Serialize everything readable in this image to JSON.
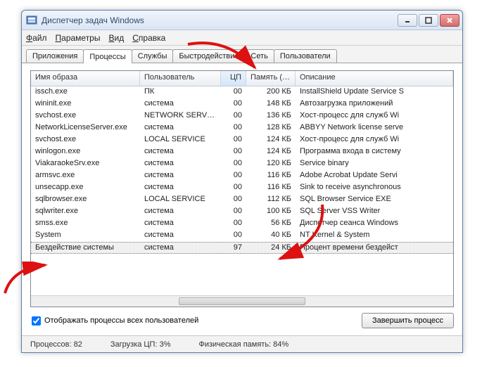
{
  "window": {
    "title": "Диспетчер задач Windows"
  },
  "menu": {
    "file": "Файл",
    "options": "Параметры",
    "view": "Вид",
    "help": "Справка"
  },
  "tabs": {
    "applications": "Приложения",
    "processes": "Процессы",
    "services": "Службы",
    "performance": "Быстродействие",
    "network": "Сеть",
    "users": "Пользователи"
  },
  "columns": {
    "image": "Имя образа",
    "user": "Пользователь",
    "cpu": "ЦП",
    "mem": "Память (ч...",
    "desc": "Описание"
  },
  "rows": [
    {
      "image": "issch.exe",
      "user": "ПК",
      "cpu": "00",
      "mem": "200 КБ",
      "desc": "InstallShield Update Service S"
    },
    {
      "image": "wininit.exe",
      "user": "система",
      "cpu": "00",
      "mem": "148 КБ",
      "desc": "Автозагрузка приложений"
    },
    {
      "image": "svchost.exe",
      "user": "NETWORK SERVICE",
      "cpu": "00",
      "mem": "136 КБ",
      "desc": "Хост-процесс для служб Wi"
    },
    {
      "image": "NetworkLicenseServer.exe",
      "user": "система",
      "cpu": "00",
      "mem": "128 КБ",
      "desc": "ABBYY Network license serve"
    },
    {
      "image": "svchost.exe",
      "user": "LOCAL SERVICE",
      "cpu": "00",
      "mem": "124 КБ",
      "desc": "Хост-процесс для служб Wi"
    },
    {
      "image": "winlogon.exe",
      "user": "система",
      "cpu": "00",
      "mem": "124 КБ",
      "desc": "Программа входа в систему"
    },
    {
      "image": "ViakaraokeSrv.exe",
      "user": "система",
      "cpu": "00",
      "mem": "120 КБ",
      "desc": "Service binary"
    },
    {
      "image": "armsvc.exe",
      "user": "система",
      "cpu": "00",
      "mem": "116 КБ",
      "desc": "Adobe Acrobat Update Servi"
    },
    {
      "image": "unsecapp.exe",
      "user": "система",
      "cpu": "00",
      "mem": "116 КБ",
      "desc": "Sink to receive asynchronous"
    },
    {
      "image": "sqlbrowser.exe",
      "user": "LOCAL SERVICE",
      "cpu": "00",
      "mem": "112 КБ",
      "desc": "SQL Browser Service EXE"
    },
    {
      "image": "sqlwriter.exe",
      "user": "система",
      "cpu": "00",
      "mem": "100 КБ",
      "desc": "SQL Server VSS Writer"
    },
    {
      "image": "smss.exe",
      "user": "система",
      "cpu": "00",
      "mem": "56 КБ",
      "desc": "Диспетчер сеанса  Windows"
    },
    {
      "image": "System",
      "user": "система",
      "cpu": "00",
      "mem": "40 КБ",
      "desc": "NT Kernel & System"
    },
    {
      "image": "Бездействие системы",
      "user": "система",
      "cpu": "97",
      "mem": "24 КБ",
      "desc": "Процент времени бездейст"
    }
  ],
  "footer": {
    "show_all": "Отображать процессы всех пользователей",
    "end_process": "Завершить процесс"
  },
  "status": {
    "processes": "Процессов: 82",
    "cpu": "Загрузка ЦП: 3%",
    "mem": "Физическая память: 84%"
  }
}
